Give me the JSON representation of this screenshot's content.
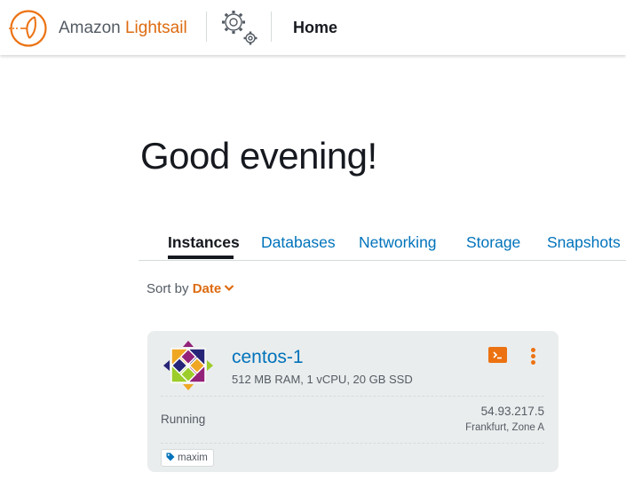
{
  "header": {
    "brand_prefix": "Amazon",
    "brand_name": "Lightsail",
    "page_title": "Home"
  },
  "greeting": "Good evening!",
  "tabs": [
    {
      "label": "Instances",
      "active": true
    },
    {
      "label": "Databases",
      "active": false
    },
    {
      "label": "Networking",
      "active": false
    },
    {
      "label": "Storage",
      "active": false
    },
    {
      "label": "Snapshots",
      "active": false
    }
  ],
  "sort": {
    "label": "Sort by",
    "value": "Date"
  },
  "instance": {
    "name": "centos-1",
    "specs": "512 MB RAM, 1 vCPU, 20 GB SSD",
    "status": "Running",
    "ip": "54.93.217.5",
    "location": "Frankfurt, Zone A",
    "tag": "maxim",
    "os_icon": "centos-logo-icon"
  },
  "colors": {
    "accent_orange": "#ec7211",
    "brand_orange": "#dd6b10",
    "link_blue": "#0073bb",
    "card_bg": "#eaeded"
  }
}
